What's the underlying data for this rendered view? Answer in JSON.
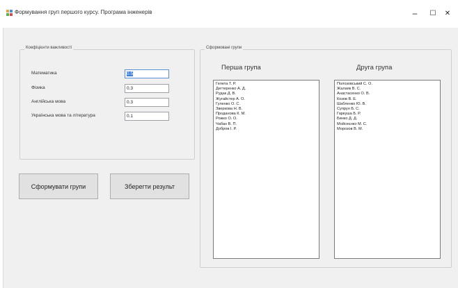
{
  "window": {
    "title": "Формування груп першого курсу. Програма інженерів",
    "minimize_glyph": "–",
    "maximize_glyph": "☐",
    "close_glyph": "✕"
  },
  "coefficients": {
    "caption": "Коефіцієнти важливості",
    "fields": [
      {
        "label": "Математика",
        "value": "0.5"
      },
      {
        "label": "Фізика",
        "value": "0.3"
      },
      {
        "label": "Англійська мова",
        "value": "0.3"
      },
      {
        "label": "Українська мова та література",
        "value": "0.1"
      }
    ]
  },
  "buttons": {
    "form_groups": "Сформувати групи",
    "save_result": "Зберегти результ"
  },
  "groups": {
    "caption": "Сформовані групи",
    "first": {
      "header": "Перша група",
      "items": [
        "Гелета Т. Р.",
        "Дегтеренко А. Д.",
        "Рудак Д. В.",
        "Жугайстер А. О.",
        "Гуленко О. С.",
        "Зверкова Н. В.",
        "Проданова К. М.",
        "Рожко О. О.",
        "Чабан В. П.",
        "Добров І. Р."
      ]
    },
    "second": {
      "header": "Друга група",
      "items": [
        "Полозовський С. О.",
        "Жалаяк В. С.",
        "Анастасенко О. В.",
        "Козов В. Е.",
        "Шабленко Ю. В.",
        "Супрун Б. С.",
        "Гаркуша Б. Р.",
        "Бинко Д. Д.",
        "Мойсеєнко М. С.",
        "Морозов В. М."
      ]
    }
  },
  "colors": {
    "selection": "#3b7ddd",
    "client_bg": "#f0f0f0"
  }
}
